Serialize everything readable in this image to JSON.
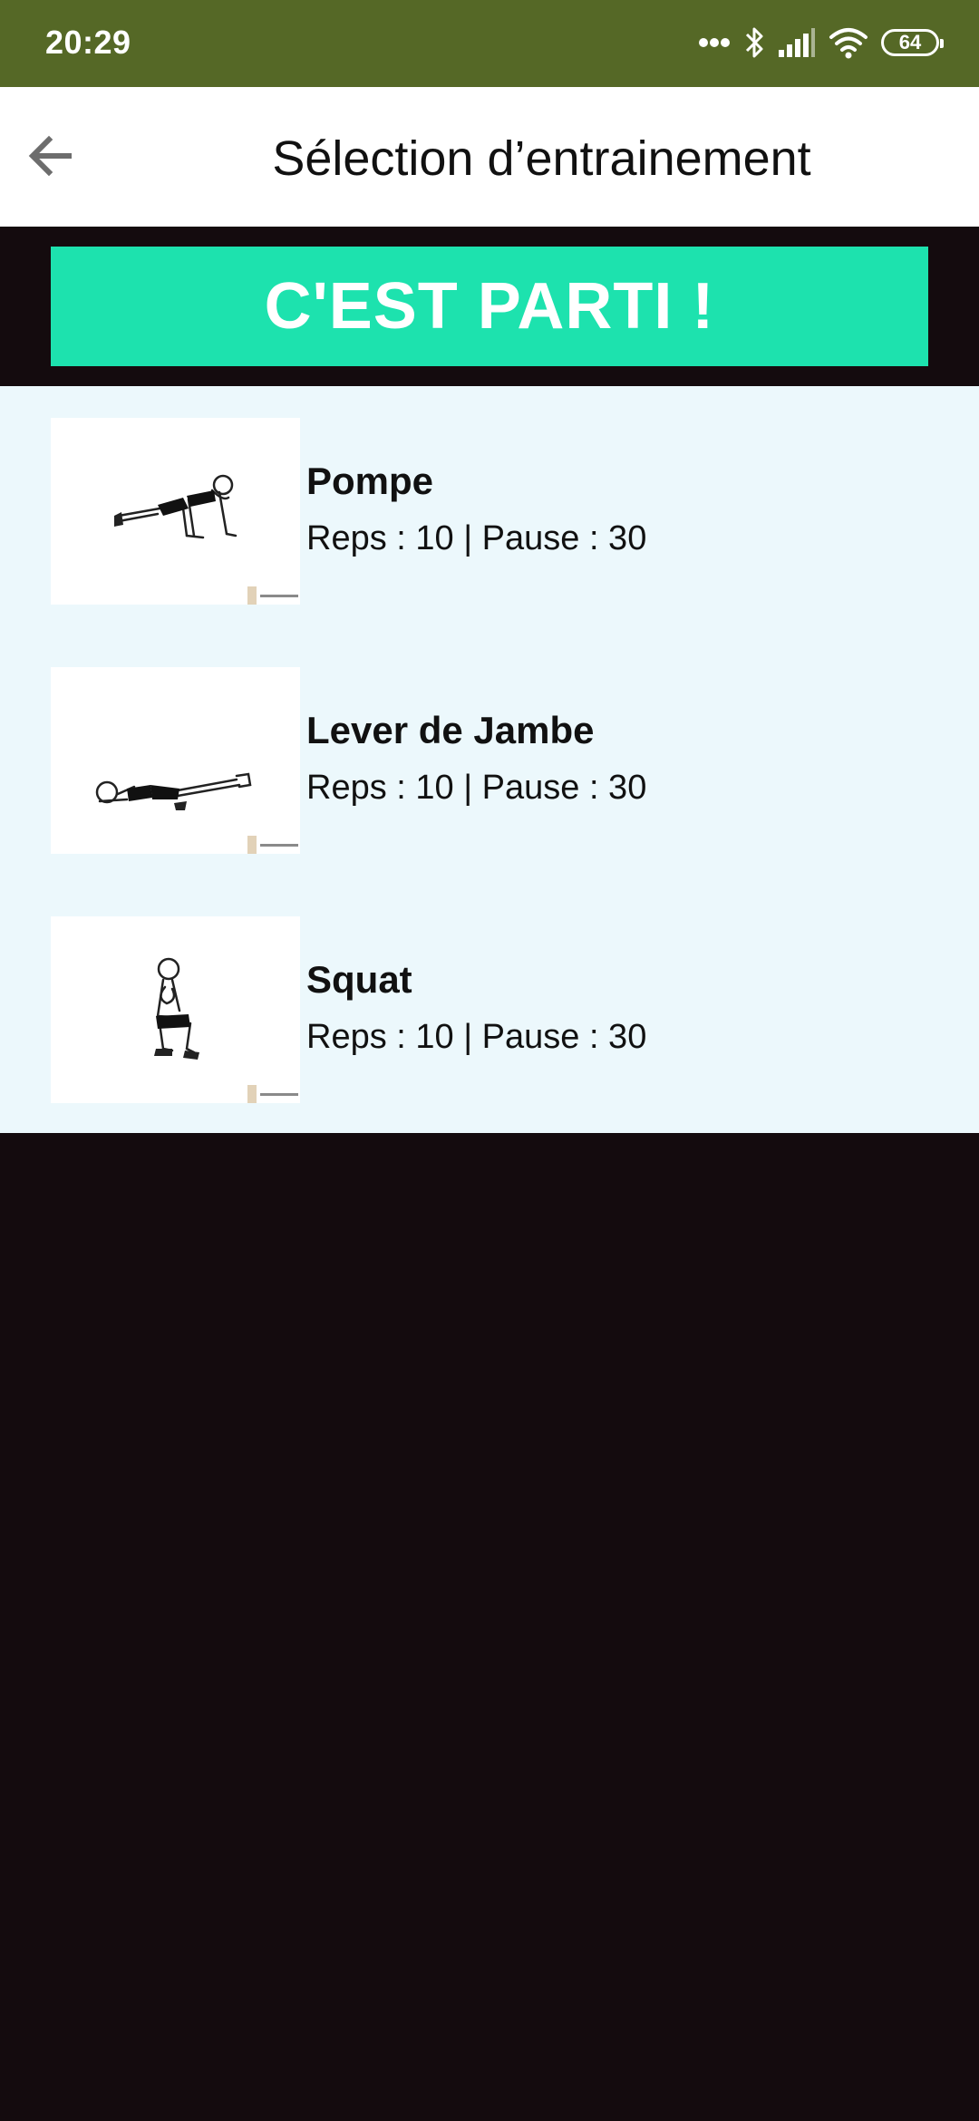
{
  "status_bar": {
    "time": "20:29",
    "battery": "64",
    "icons": [
      "more-dots-icon",
      "bluetooth-icon",
      "signal-icon",
      "wifi-icon",
      "battery-icon"
    ]
  },
  "app_bar": {
    "back_icon": "arrow-left-icon",
    "title": "Sélection d’entrainement"
  },
  "start": {
    "label": "C'EST PARTI !"
  },
  "exercises": [
    {
      "name": "Pompe",
      "meta": "Reps : 10 | Pause : 30",
      "image": "push-up-illustration"
    },
    {
      "name": "Lever de Jambe",
      "meta": "Reps : 10 | Pause : 30",
      "image": "leg-raise-illustration"
    },
    {
      "name": "Squat",
      "meta": "Reps : 10 | Pause : 30",
      "image": "squat-illustration"
    }
  ],
  "colors": {
    "status_bar": "#556826",
    "app_bar": "#ffffff",
    "start_button": "#1de2ae",
    "list_background": "#ecf8fc",
    "page_background": "#140b0e"
  }
}
